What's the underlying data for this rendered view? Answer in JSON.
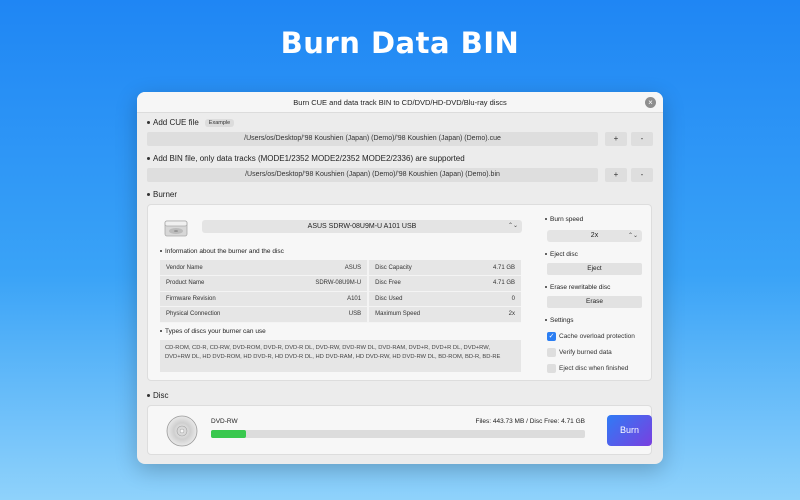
{
  "hero_title": "Burn Data BIN",
  "window": {
    "title": "Burn CUE and data track BIN to CD/DVD/HD-DVD/Blu-ray discs",
    "close_glyph": "×"
  },
  "cue": {
    "label": "Add CUE file",
    "example_badge": "Example",
    "path": "/Users/os/Desktop/'98 Koushien (Japan) (Demo)/'98 Koushien (Japan) (Demo).cue",
    "add": "+",
    "remove": "-"
  },
  "bin": {
    "label": "Add BIN file, only data tracks (MODE1/2352 MODE2/2352 MODE2/2336) are supported",
    "path": "/Users/os/Desktop/'98 Koushien (Japan) (Demo)/'98 Koushien (Japan) (Demo).bin",
    "add": "+",
    "remove": "-"
  },
  "burner": {
    "label": "Burner",
    "device": "ASUS SDRW-08U9M-U A101 USB",
    "info_label": "Information about the burner and the disc",
    "info_rows": [
      {
        "k1": "Vendor Name",
        "v1": "ASUS",
        "k2": "Disc Capacity",
        "v2": "4.71 GB"
      },
      {
        "k1": "Product Name",
        "v1": "SDRW-08U9M-U",
        "k2": "Disc Free",
        "v2": "4.71 GB"
      },
      {
        "k1": "Firmware Revision",
        "v1": "A101",
        "k2": "Disc Used",
        "v2": "0"
      },
      {
        "k1": "Physical Connection",
        "v1": "USB",
        "k2": "Maximum Speed",
        "v2": "2x"
      }
    ],
    "types_label": "Types of discs your burner can use",
    "types_text": "CD-ROM, CD-R, CD-RW, DVD-ROM, DVD-R, DVD-R DL, DVD-RW, DVD-RW DL, DVD-RAM, DVD+R, DVD+R DL, DVD+RW, DVD+RW DL, HD DVD-ROM, HD DVD-R, HD DVD-R DL, HD DVD-RAM, HD DVD-RW, HD DVD-RW DL, BD-ROM, BD-R, BD-RE"
  },
  "settings_panel": {
    "speed_label": "Burn speed",
    "speed_value": "2x",
    "eject_label": "Eject disc",
    "eject_button": "Eject",
    "erase_label": "Erase rewritable disc",
    "erase_button": "Erase",
    "settings_label": "Settings",
    "options": [
      {
        "label": "Cache overload protection",
        "checked": true
      },
      {
        "label": "Verify burned data",
        "checked": false
      },
      {
        "label": "Eject disc when finished",
        "checked": false
      }
    ]
  },
  "disc": {
    "label": "Disc",
    "type": "DVD-RW",
    "status": "Files: 443.73 MB / Disc Free: 4.71 GB",
    "progress_fraction": 0.094,
    "burn_button": "Burn"
  },
  "colors": {
    "accent": "#2b7ef3",
    "progress": "#39c84e",
    "burn_gradient_start": "#2f7bf5",
    "burn_gradient_end": "#7a3fe0"
  }
}
